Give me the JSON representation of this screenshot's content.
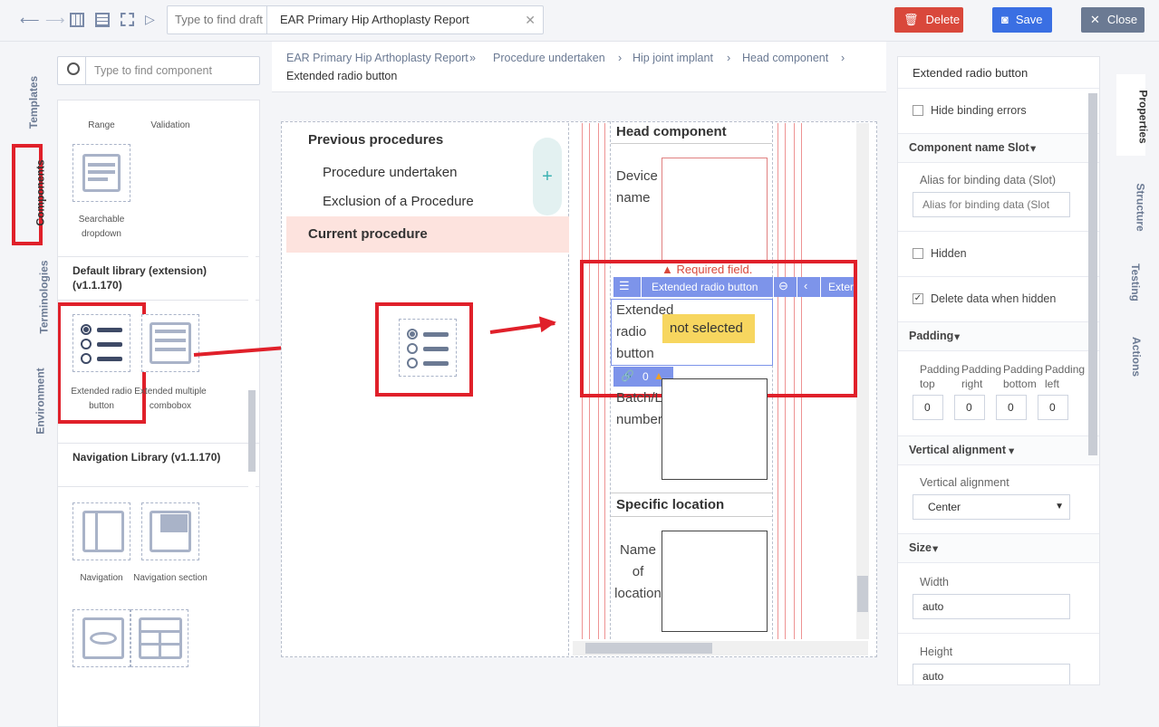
{
  "toolbar": {
    "draft_placeholder": "Type to find draft",
    "draft_value": "EAR Primary Hip Arthoplasty Report",
    "clear": "✕",
    "delete_label": "Delete",
    "save_label": "Save",
    "close_label": "Close",
    "colors": {
      "delete": "#d9483b",
      "save": "#3a6fe3",
      "close": "#6b7a93"
    }
  },
  "left_tabs": [
    "Templates",
    "Components",
    "Terminologies",
    "Environment"
  ],
  "components": {
    "search_placeholder": "Type to find component",
    "top_items": [
      {
        "label": "Range"
      },
      {
        "label": "Validation"
      }
    ],
    "searchable": "Searchable dropdown",
    "lib_default": "Default library (extension) (v1.1.170)",
    "default_items": [
      "Extended radio button",
      "Extended multiple combobox"
    ],
    "lib_nav": "Navigation Library (v1.1.170)",
    "nav_items": [
      "Navigation",
      "Navigation section"
    ]
  },
  "breadcrumb": [
    "EAR Primary Hip Arthoplasty Report",
    "Procedure undertaken",
    "Hip joint implant",
    "Head component",
    "Extended radio button"
  ],
  "nav": {
    "previous": "Previous procedures",
    "items": [
      "Procedure undertaken",
      "Exclusion of a Procedure"
    ],
    "current": "Current procedure",
    "plus": "+"
  },
  "form": {
    "head_component": "Head component",
    "device_name": "Device name",
    "required": "Required field.",
    "toolbar_label": "Extended radio button",
    "toolbar_cut": "Exter",
    "ext_label": "Extended radio button",
    "not_selected": "not selected",
    "link_count": "0",
    "batch": "Batch/L number",
    "specific_location": "Specific location",
    "name_of_location": "Name of location"
  },
  "properties": {
    "title": "Extended radio button",
    "hide_binding": "Hide binding errors",
    "slot_section": "Component name Slot",
    "alias_label": "Alias for binding data (Slot)",
    "alias_placeholder": "Alias for binding data  (Slot",
    "hidden": "Hidden",
    "delete_hidden": "Delete data when hidden",
    "padding_section": "Padding",
    "padding_labels": [
      "Padding top",
      "Padding right",
      "Padding bottom",
      "Padding left"
    ],
    "padding_values": [
      "0",
      "0",
      "0",
      "0"
    ],
    "valign_section": "Vertical alignment",
    "valign_label": "Vertical alignment",
    "valign_value": "Center",
    "size_section": "Size",
    "width_label": "Width",
    "width_value": "auto",
    "height_label": "Height",
    "height_value": "auto"
  },
  "right_tabs": [
    "Properties",
    "Structure",
    "Testing",
    "Actions"
  ]
}
